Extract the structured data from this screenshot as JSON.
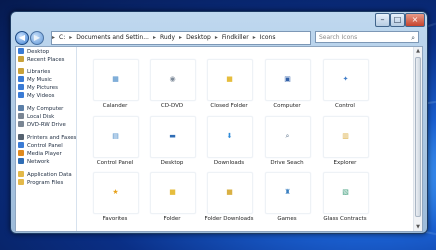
{
  "window": {
    "caption_buttons": [
      "–",
      "□",
      "×"
    ]
  },
  "nav": {
    "back_icon": "◀",
    "forward_icon": "▶",
    "address_segments": [
      "C:",
      "Documents and Settin...",
      "Rudy",
      "Desktop",
      "Findkiller",
      "Icons"
    ],
    "separator": "▸",
    "search_placeholder": "Search Icons",
    "search_icon": "⌕"
  },
  "sidebar": {
    "items": [
      {
        "label": "Desktop",
        "icon": "desktop-icon",
        "color": "#3a7bd5"
      },
      {
        "label": "Recent Places",
        "icon": "recent-places-icon",
        "color": "#c9a23a"
      },
      {
        "label": "Libraries",
        "icon": "libraries-icon",
        "color": "#c9a23a"
      },
      {
        "label": "My Music",
        "icon": "music-icon",
        "color": "#3a7bd5"
      },
      {
        "label": "My Pictures",
        "icon": "pictures-icon",
        "color": "#3a7bd5"
      },
      {
        "label": "My Videos",
        "icon": "videos-icon",
        "color": "#3a7bd5"
      },
      {
        "label": "My Computer",
        "icon": "computer-icon",
        "color": "#5b7fa8"
      },
      {
        "label": "Local Disk",
        "icon": "disk-icon",
        "color": "#7a8694"
      },
      {
        "label": "DVD-RW Drive",
        "icon": "dvd-icon",
        "color": "#7a8694"
      },
      {
        "label": "Printers and Faxes",
        "icon": "printer-icon",
        "color": "#556270"
      },
      {
        "label": "Control Panel",
        "icon": "control-panel-icon",
        "color": "#3a7bd5"
      },
      {
        "label": "Media Player",
        "icon": "media-player-icon",
        "color": "#e08a1e"
      },
      {
        "label": "Network",
        "icon": "network-icon",
        "color": "#2f6db5"
      },
      {
        "label": "Application Data",
        "icon": "folder-icon",
        "color": "#e3b94a"
      },
      {
        "label": "Program Files",
        "icon": "folder-icon",
        "color": "#e3b94a"
      }
    ]
  },
  "items": [
    {
      "label": "Calander",
      "icon": "calendar-icon",
      "glyph": "▦",
      "color": "#3b82c4"
    },
    {
      "label": "CD-DVD",
      "icon": "cd-dvd-icon",
      "glyph": "◉",
      "color": "#7d8a99"
    },
    {
      "label": "Closed Folder",
      "icon": "closed-folder-icon",
      "glyph": "■",
      "color": "#e6bd3d"
    },
    {
      "label": "Computer",
      "icon": "computer-icon",
      "glyph": "▣",
      "color": "#3160a8"
    },
    {
      "label": "Control",
      "icon": "control-icon",
      "glyph": "✦",
      "color": "#3f7cc8"
    },
    {
      "label": "Control Panel",
      "icon": "control-panel-icon",
      "glyph": "▤",
      "color": "#3b82c4"
    },
    {
      "label": "Desktop",
      "icon": "desktop-icon",
      "glyph": "▬",
      "color": "#2f6db5"
    },
    {
      "label": "Downloads",
      "icon": "downloads-icon",
      "glyph": "⬇",
      "color": "#2f8bd8"
    },
    {
      "label": "Drive Seach",
      "icon": "drive-search-icon",
      "glyph": "⌕",
      "color": "#59708a"
    },
    {
      "label": "Explorer",
      "icon": "explorer-icon",
      "glyph": "▥",
      "color": "#d9a93a"
    },
    {
      "label": "Favorites",
      "icon": "favorites-icon",
      "glyph": "★",
      "color": "#e7a21c"
    },
    {
      "label": "Folder",
      "icon": "folder-icon",
      "glyph": "■",
      "color": "#e6bd3d"
    },
    {
      "label": "Folder Downloads",
      "icon": "folder-downloads-icon",
      "glyph": "■",
      "color": "#d9b043"
    },
    {
      "label": "Games",
      "icon": "games-icon",
      "glyph": "♜",
      "color": "#3a7fc0"
    },
    {
      "label": "Glass Contracts",
      "icon": "glass-contracts-icon",
      "glyph": "▧",
      "color": "#3c9c7a"
    }
  ]
}
